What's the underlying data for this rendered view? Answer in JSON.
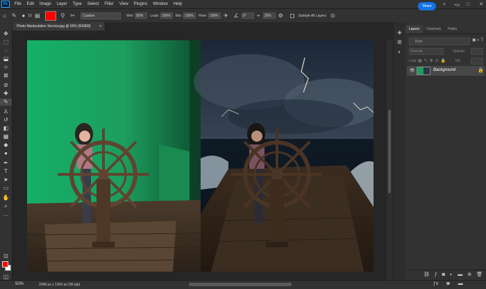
{
  "app": {
    "logo": "Ps"
  },
  "menu": [
    "File",
    "Edit",
    "Image",
    "Layer",
    "Type",
    "Select",
    "Filter",
    "View",
    "Plugins",
    "Window",
    "Help"
  ],
  "window_controls": [
    "–",
    "□",
    "✕"
  ],
  "options": {
    "preset": "Custom",
    "wet_label": "Wet:",
    "wet_value": "80%",
    "load_label": "Load:",
    "load_value": "100%",
    "mix_label": "Mix:",
    "mix_value": "100%",
    "flow_label": "Flow:",
    "flow_value": "100%",
    "angle_value": "0°",
    "smoothing_value": "10%",
    "sample_label": "Sample All Layers",
    "share_label": "Share",
    "brush_size": "15",
    "foreground_color": "#ff0000"
  },
  "document": {
    "tab_title": "Photo Manipulation Service.jpg @ 50% (RGB/8)",
    "close_glyph": "✕"
  },
  "status": {
    "zoom": "50%",
    "info": "2048 px x 1364 px (96 ppi)"
  },
  "layers_panel": {
    "tabs": [
      "Layers",
      "Channels",
      "Paths"
    ],
    "kind_placeholder": "Kind",
    "blend_mode": "Normal",
    "opacity_label": "Opacity:",
    "lock_label": "Lock:",
    "fill_label": "Fill:",
    "layers": [
      {
        "name": "Background",
        "visible": true,
        "locked": true
      }
    ]
  },
  "colors": {
    "accent": "#1473e6",
    "background_color": "#ffffff",
    "green_screen": "#1e9e5c"
  }
}
